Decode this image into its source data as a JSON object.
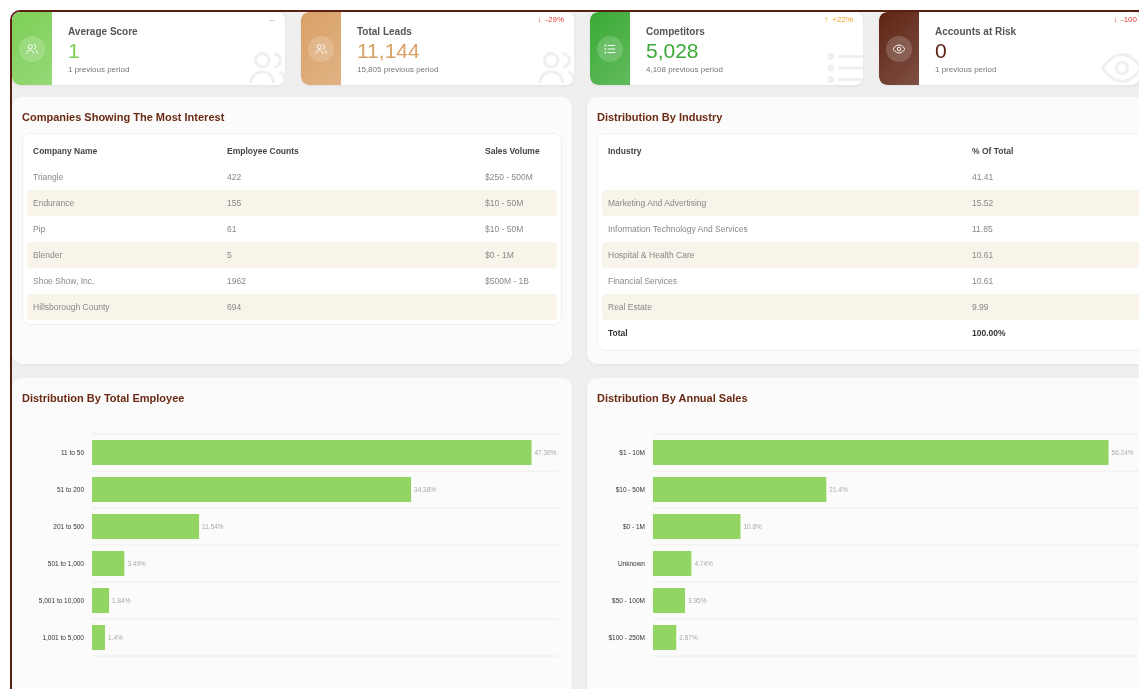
{
  "kpis": [
    {
      "title": "Average Score",
      "value": "1",
      "previous": "1 previous period",
      "kind": "people",
      "color": "#7ccf56",
      "delta": {
        "kind": "neutral",
        "text": "--"
      }
    },
    {
      "title": "Total Leads",
      "value": "11,144",
      "previous": "15,805 previous period",
      "kind": "people",
      "color": "#d9a066",
      "delta": {
        "kind": "down",
        "arrow": "↓",
        "text": "-29%"
      }
    },
    {
      "title": "Competitors",
      "value": "5,028",
      "previous": "4,108 previous period",
      "kind": "list",
      "color": "#3aaa35",
      "delta": {
        "kind": "up",
        "arrow": "↑",
        "text": "+22%"
      }
    },
    {
      "title": "Accounts at Risk",
      "value": "0",
      "previous": "1 previous period",
      "kind": "eye",
      "color": "#5e2414",
      "delta": {
        "kind": "down",
        "arrow": "↓",
        "text": "-100"
      }
    }
  ],
  "companies": {
    "title": "Companies Showing The Most Interest",
    "columns": [
      "Company Name",
      "Employee Counts",
      "Sales Volume"
    ],
    "rows": [
      [
        "Triangle",
        "422",
        "$250 - 500M"
      ],
      [
        "Endurance",
        "155",
        "$10 - 50M"
      ],
      [
        "Pip",
        "61",
        "$10 - 50M"
      ],
      [
        "Blender",
        "5",
        "$0 - 1M"
      ],
      [
        "Shoe Show, Inc.",
        "1962",
        "$500M - 1B"
      ],
      [
        "Hillsborough County",
        "694",
        ""
      ]
    ]
  },
  "industry": {
    "title": "Distribution By Industry",
    "columns": [
      "Industry",
      "% Of Total"
    ],
    "rows": [
      [
        "",
        "41.41"
      ],
      [
        "Marketing And Advertising",
        "15.52"
      ],
      [
        "Information Technology And Services",
        "11.85"
      ],
      [
        "Hospital & Health Care",
        "10.61"
      ],
      [
        "Financial Services",
        "10.61"
      ],
      [
        "Real Estate",
        "9.99"
      ]
    ],
    "total": [
      "Total",
      "100.00%"
    ]
  },
  "employee_chart": {
    "title": "Distribution By Total Employee",
    "chart_data": {
      "type": "bar",
      "orientation": "horizontal",
      "categories": [
        "11 to 50",
        "51 to 200",
        "201 to 500",
        "501 to 1,000",
        "5,001 to 10,000",
        "1,001 to 5,000"
      ],
      "values": [
        47.36,
        34.38,
        11.54,
        3.49,
        1.84,
        1.4
      ],
      "value_labels": [
        "47.36%",
        "34.38%",
        "11.54%",
        "3.49%",
        "1.84%",
        "1.4%"
      ],
      "xlim": [
        0,
        50
      ]
    }
  },
  "sales_chart": {
    "title": "Distribution By Annual Sales",
    "chart_data": {
      "type": "bar",
      "orientation": "horizontal",
      "categories": [
        "$1 - 10M",
        "$10 - 50M",
        "$0 - 1M",
        "Unknown",
        "$50 - 100M",
        "$100 - 250M"
      ],
      "values": [
        56.24,
        21.4,
        10.8,
        4.74,
        3.95,
        2.87
      ],
      "value_labels": [
        "56.24%",
        "21.4%",
        "10.8%",
        "4.74%",
        "3.95%",
        "2.87%"
      ],
      "xlim": [
        0,
        60
      ]
    }
  }
}
